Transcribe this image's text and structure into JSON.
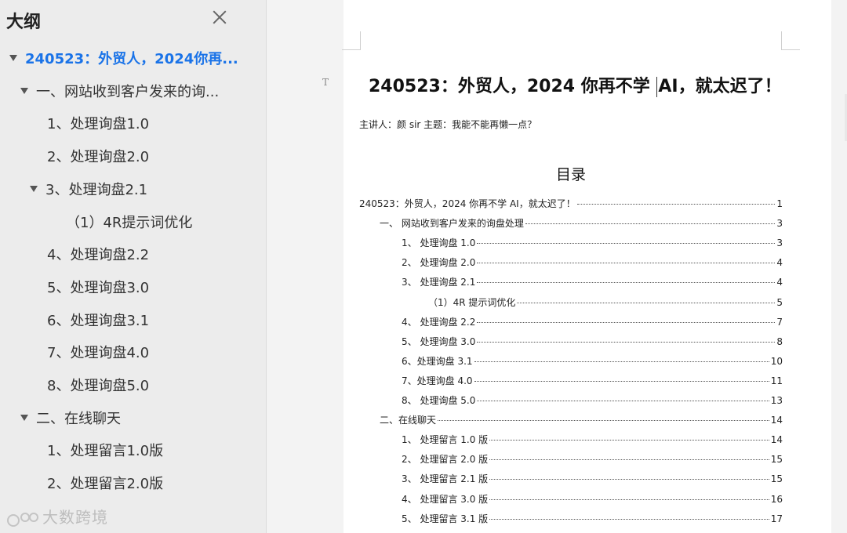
{
  "sidebar": {
    "title": "大纲",
    "items": [
      {
        "label": "240523：外贸人，2024你再...",
        "active": true,
        "expanded": true,
        "level": 0
      },
      {
        "label": "一、网站收到客户发来的询...",
        "expanded": true,
        "level": 1
      },
      {
        "label": "1、处理询盘1.0",
        "level": 2
      },
      {
        "label": "2、处理询盘2.0",
        "level": 2
      },
      {
        "label": "3、处理询盘2.1",
        "expanded": true,
        "level": 2
      },
      {
        "label": "（1）4R提示词优化",
        "level": 3
      },
      {
        "label": "4、处理询盘2.2",
        "level": 2
      },
      {
        "label": "5、处理询盘3.0",
        "level": 2
      },
      {
        "label": "6、处理询盘3.1",
        "level": 2
      },
      {
        "label": "7、处理询盘4.0",
        "level": 2
      },
      {
        "label": "8、处理询盘5.0",
        "level": 2
      },
      {
        "label": "二、在线聊天",
        "expanded": true,
        "level": 1
      },
      {
        "label": "1、处理留言1.0版",
        "level": 2
      },
      {
        "label": "2、处理留言2.0版",
        "level": 2
      }
    ]
  },
  "watermark": "大数跨境",
  "document": {
    "t_marker": "T",
    "title_before_caret": "240523：外贸人，2024 你再不学 ",
    "title_after_caret": "AI，就太迟了！",
    "subtitle": "主讲人：颜 sir   主题：我能不能再懒一点？",
    "toc_heading": "目录",
    "toc": [
      {
        "text": "240523：外贸人，2024 你再不学 AI，就太迟了！",
        "page": "1",
        "indent": 0
      },
      {
        "text": "一、  网站收到客户发来的询盘处理",
        "page": "3",
        "indent": 1
      },
      {
        "text": "1、  处理询盘 1.0",
        "page": "3",
        "indent": 2
      },
      {
        "text": "2、  处理询盘 2.0",
        "page": "4",
        "indent": 2
      },
      {
        "text": "3、  处理询盘 2.1",
        "page": "4",
        "indent": 2
      },
      {
        "text": "（1）4R 提示词优化",
        "page": "5",
        "indent": 3
      },
      {
        "text": "4、  处理询盘 2.2",
        "page": "7",
        "indent": 2
      },
      {
        "text": "5、  处理询盘 3.0",
        "page": "8",
        "indent": 2
      },
      {
        "text": "6、处理询盘 3.1",
        "page": "10",
        "indent": 2
      },
      {
        "text": "7、处理询盘 4.0",
        "page": "11",
        "indent": 2
      },
      {
        "text": "8、  处理询盘 5.0",
        "page": "13",
        "indent": 2
      },
      {
        "text": "二、在线聊天",
        "page": "14",
        "indent": 1
      },
      {
        "text": "1、  处理留言 1.0 版",
        "page": "14",
        "indent": 2
      },
      {
        "text": "2、  处理留言 2.0 版",
        "page": "15",
        "indent": 2
      },
      {
        "text": "3、  处理留言 2.1 版",
        "page": "15",
        "indent": 2
      },
      {
        "text": "4、  处理留言 3.0 版",
        "page": "16",
        "indent": 2
      },
      {
        "text": "5、  处理留言 3.1 版",
        "page": "17",
        "indent": 2
      }
    ]
  },
  "colors": {
    "active": "#1a73e8",
    "sidebar_bg": "#ececec",
    "page_bg": "#ffffff"
  }
}
